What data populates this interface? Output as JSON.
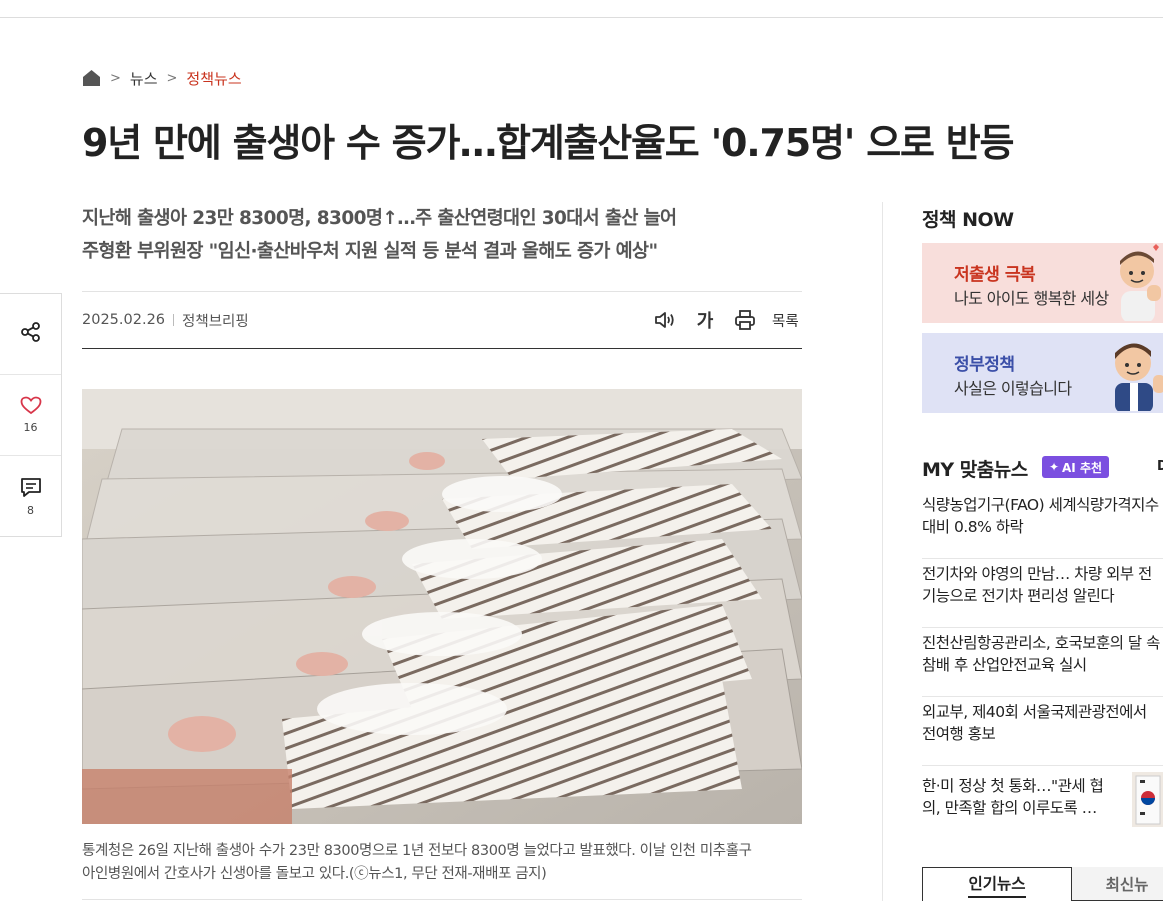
{
  "breadcrumb": {
    "items": [
      "뉴스",
      "정책뉴스"
    ]
  },
  "article": {
    "title": "9년 만에 출생아 수 증가…합계출산율도 '0.75명' 으로 반등",
    "subtitle_lines": [
      "지난해 출생아 23만 8300명, 8300명↑…주 출산연령대인 30대서 출산 늘어",
      "주형환 부위원장 \"임신·출산바우처 지원 실적 등 분석 결과 올해도 증가 예상\""
    ],
    "date": "2025.02.26",
    "source": "정책브리핑",
    "font_tool_label": "가",
    "list_label": "목록",
    "caption_lines": [
      "통계청은 26일 지난해 출생아 수가 23만 8300명으로 1년 전보다 8300명 늘었다고 발표했다. 이날 인천 미추홀구",
      "아인병원에서 간호사가 신생아를 돌보고 있다.(ⓒ뉴스1, 무단 전재-재배포 금지)"
    ]
  },
  "side_actions": {
    "like_count": "16",
    "comment_count": "8"
  },
  "sidebar": {
    "now_title": "정책 NOW",
    "banners": [
      {
        "head": "저출생 극복",
        "sub": "나도 아이도 행복한 세상"
      },
      {
        "head": "정부정책",
        "sub": "사실은 이렇습니다"
      }
    ],
    "my_title": "MY 맞춤뉴스",
    "ai_badge": "AI 추천",
    "my_more": "D",
    "news": [
      {
        "line1": "식량농업기구(FAO) 세계식량가격지수",
        "line2": "대비 0.8% 하락"
      },
      {
        "line1": "전기차와 야영의 만남… 차량 외부 전",
        "line2": "기능으로 전기차 편리성 알린다"
      },
      {
        "line1": "진천산림항공관리소, 호국보훈의 달 속",
        "line2": "참배 후 산업안전교육 실시"
      },
      {
        "line1": "외교부, 제40회 서울국제관광전에서",
        "line2": "전여행 홍보"
      },
      {
        "line1": "한·미 정상 첫 통화…\"관세 협",
        "line2": "의, 만족할 합의 이루도록 …"
      }
    ],
    "tabs": [
      "인기뉴스",
      "최신뉴"
    ]
  },
  "colors": {
    "accent": "#c9341f",
    "ai_badge": "#7b4fe0"
  }
}
